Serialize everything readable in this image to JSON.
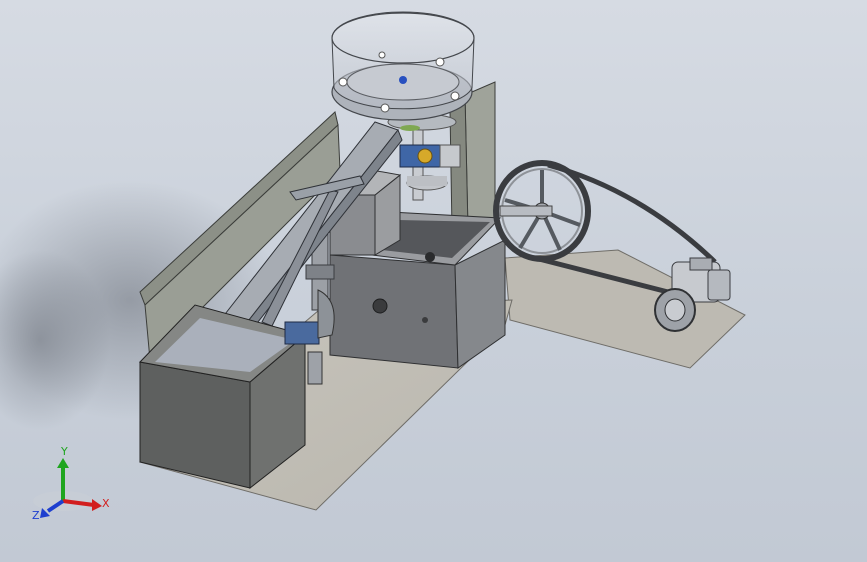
{
  "viewport": {
    "background_top": "#d6dbe3",
    "background_bottom": "#c2c9d4"
  },
  "triad": {
    "x_label": "X",
    "y_label": "Y",
    "z_label": "Z",
    "x_color": "#d21e1e",
    "y_color": "#1fa51f",
    "z_color": "#1e3fcf"
  }
}
